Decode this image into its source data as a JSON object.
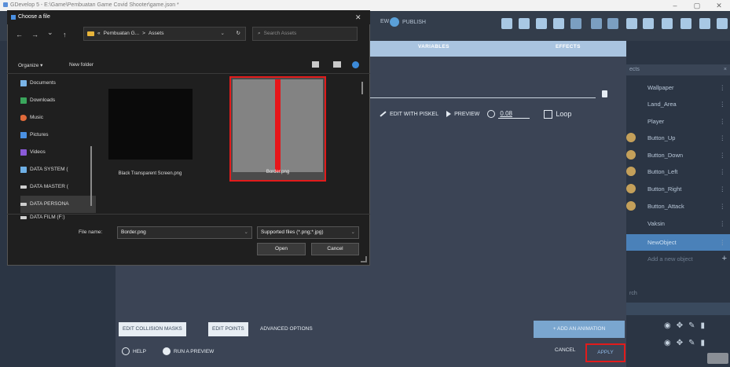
{
  "app": {
    "title": "GDevelop 5 - E:\\Game\\Pembuatan Game Covid Shooter\\game.json *",
    "window_controls": [
      "–",
      "▢",
      "✕"
    ]
  },
  "toolbar": {
    "preview_label": "EW",
    "publish_label": "PUBLISH"
  },
  "editor": {
    "tabs": [
      "VARIABLES",
      "EFFECTS"
    ],
    "anim_toolbar": {
      "edit_label": "EDIT WITH PISKEL",
      "preview_label": "PREVIEW",
      "duration": "0.08",
      "loop_label": "Loop"
    },
    "footer": {
      "edit_collision_masks": "EDIT COLLISION MASKS",
      "edit_points": "EDIT POINTS",
      "advanced_options": "ADVANCED OPTIONS",
      "add_animation": "ADD AN ANIMATION",
      "add_animation_plus": "+",
      "help": "HELP",
      "run_preview": "RUN A PREVIEW",
      "cancel": "CANCEL",
      "apply": "APPLY"
    }
  },
  "objects_panel": {
    "header": "ects",
    "close": "×",
    "items": [
      {
        "name": "Wallpaper"
      },
      {
        "name": "Land_Area"
      },
      {
        "name": "Player"
      },
      {
        "name": "Button_Up"
      },
      {
        "name": "Button_Down"
      },
      {
        "name": "Button_Left"
      },
      {
        "name": "Button_Right"
      },
      {
        "name": "Button_Attack"
      },
      {
        "name": "Vaksin"
      },
      {
        "name": "NewObject"
      }
    ],
    "add_new": "Add a new object",
    "add_plus": "+",
    "groups_header": "rch",
    "kebab": "⋮",
    "layer_icons": [
      "◉",
      "✥",
      "✎",
      "▮"
    ]
  },
  "file_dialog": {
    "title": "Choose a file",
    "close": "✕",
    "nav": [
      "←",
      "→",
      "⌄",
      "↑"
    ],
    "breadcrumb": [
      "«",
      "Pembuatan G...",
      ">",
      "Assets"
    ],
    "address_chevron": "⌄",
    "refresh": "↻",
    "search_placeholder": "Search Assets",
    "search_icon": "⌕",
    "organize": "Organize ▾",
    "new_folder": "New folder",
    "tree": [
      {
        "label": "Documents",
        "color": "#7ab4e6"
      },
      {
        "label": "Downloads",
        "color": "#3aa65c"
      },
      {
        "label": "Music",
        "color": "#e06a3a"
      },
      {
        "label": "Pictures",
        "color": "#4a90e2"
      },
      {
        "label": "Videos",
        "color": "#8a5ad8"
      },
      {
        "label": "DATA SYSTEM (",
        "color": "#6fb0e6"
      },
      {
        "label": "DATA MASTER (",
        "color": "#cfcfcf"
      },
      {
        "label": "DATA PERSONA",
        "color": "#cfcfcf"
      },
      {
        "label": "DATA FILM (F:)",
        "color": "#cfcfcf"
      }
    ],
    "tree_chevron": "›",
    "files": [
      {
        "name": "Black Transparent Screen.png"
      },
      {
        "name": "Border.png"
      }
    ],
    "file_name_label": "File name:",
    "file_name_value": "Border.png",
    "file_type": "Supported files (*.png;*.jpg)",
    "dropdown_arrow": "⌄",
    "open": "Open",
    "cancel": "Cancel"
  }
}
